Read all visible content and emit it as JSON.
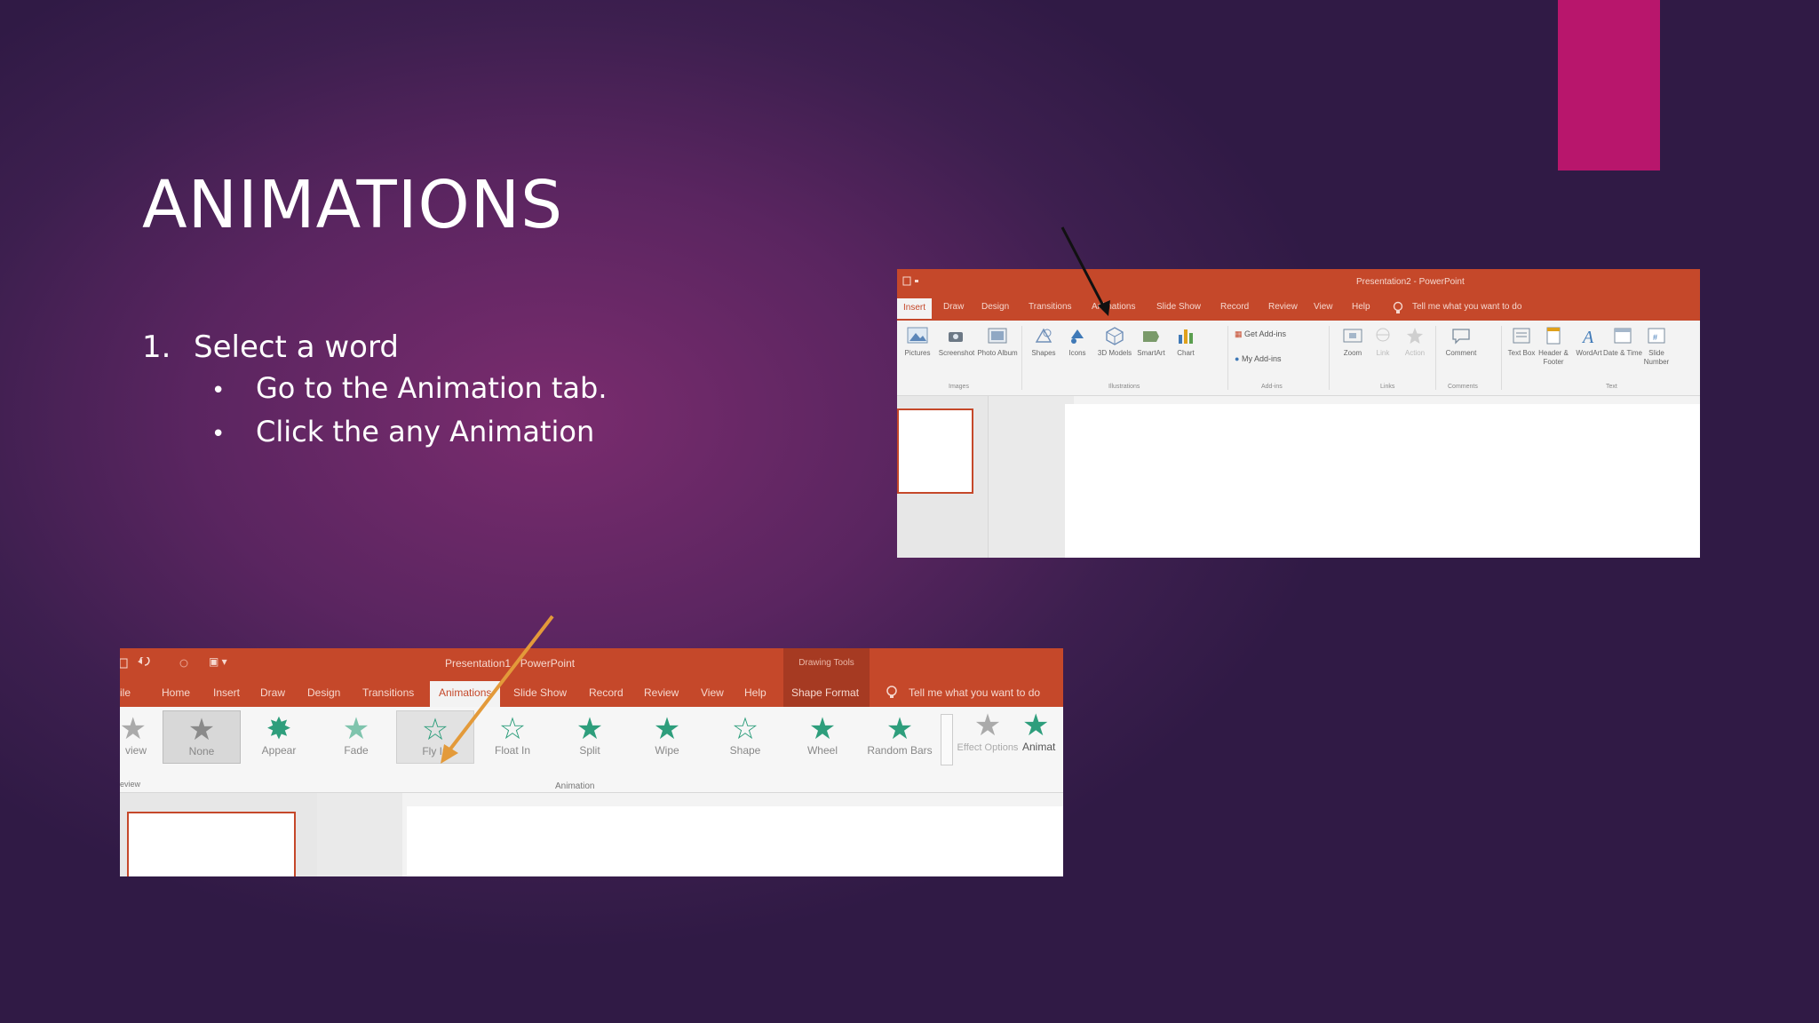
{
  "slide": {
    "title": "ANIMATIONS",
    "step_number": "1.",
    "step_text": "Select a word",
    "bullet_char": "•",
    "bullets": [
      "Go to the Animation tab.",
      "Click the any Animation"
    ]
  },
  "colors": {
    "accent": "#b8166c",
    "ribbon": "#c5482a",
    "star": "#2e9e7c"
  },
  "shot1": {
    "title": "Presentation2 - PowerPoint",
    "tabs": [
      "Insert",
      "Draw",
      "Design",
      "Transitions",
      "Animations",
      "Slide Show",
      "Record",
      "Review",
      "View",
      "Help",
      "Tell me what you want to do"
    ],
    "ribbon_items": [
      "Pictures",
      "Screenshot",
      "Photo Album",
      "Shapes",
      "Icons",
      "3D Models",
      "SmartArt",
      "Chart",
      "Get Add-ins",
      "My Add-ins",
      "Zoom",
      "Link",
      "Action",
      "Comment",
      "Text Box",
      "Header & Footer",
      "WordArt",
      "Date & Time",
      "Slide Number"
    ],
    "groups": [
      "Images",
      "Illustrations",
      "Add-ins",
      "Links",
      "Comments",
      "Text"
    ]
  },
  "shot2": {
    "title": "Presentation1 - PowerPoint",
    "context": "Drawing Tools",
    "tabs": [
      "ile",
      "Home",
      "Insert",
      "Draw",
      "Design",
      "Transitions",
      "Animations",
      "Slide Show",
      "Record",
      "Review",
      "View",
      "Help",
      "Shape Format",
      "Tell me what you want to do"
    ],
    "preview": "view",
    "animations": [
      "None",
      "Appear",
      "Fade",
      "Fly In",
      "Float In",
      "Split",
      "Wipe",
      "Shape",
      "Wheel",
      "Random Bars"
    ],
    "effect_options": "Effect Options",
    "add_animation": "Animat",
    "group_label": "Animation",
    "preview_group": "eview"
  }
}
